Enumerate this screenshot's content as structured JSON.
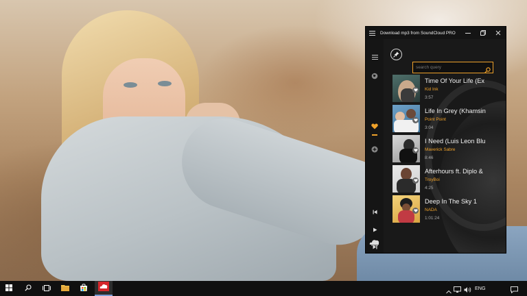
{
  "app": {
    "title": "Download mp3 from SoundCloud PRO",
    "accent": "#f0a22a"
  },
  "search": {
    "placeholder": "search query",
    "value": ""
  },
  "sidebar": {
    "items": [
      {
        "name": "menu-icon"
      },
      {
        "name": "globe-icon"
      },
      {
        "name": "heart-icon",
        "active": true
      },
      {
        "name": "add-icon"
      },
      {
        "name": "previous-icon"
      },
      {
        "name": "play-icon"
      },
      {
        "name": "next-icon"
      },
      {
        "name": "soundcloud-logo-icon"
      }
    ]
  },
  "tracks": [
    {
      "title": "Time Of Your Life (Ex",
      "artist": "Kid Ink",
      "duration": "3:57"
    },
    {
      "title": "Life In Grey (Khamsin",
      "artist": "Point Point",
      "duration": "3:04"
    },
    {
      "title": "I Need (Luis Leon Blu",
      "artist": "Maverick Sabre",
      "duration": "8:46"
    },
    {
      "title": "Afterhours ft. Diplo &",
      "artist": "TroyBoi",
      "duration": "4:25"
    },
    {
      "title": "Deep In The Sky 1",
      "artist": "NADA",
      "duration": "1:01:24"
    }
  ],
  "taskbar": {
    "language": "ENG",
    "icons": [
      "windows-start-icon",
      "search-icon",
      "task-view-icon",
      "file-explorer-icon",
      "store-icon",
      "soundcloud-app-icon"
    ]
  }
}
